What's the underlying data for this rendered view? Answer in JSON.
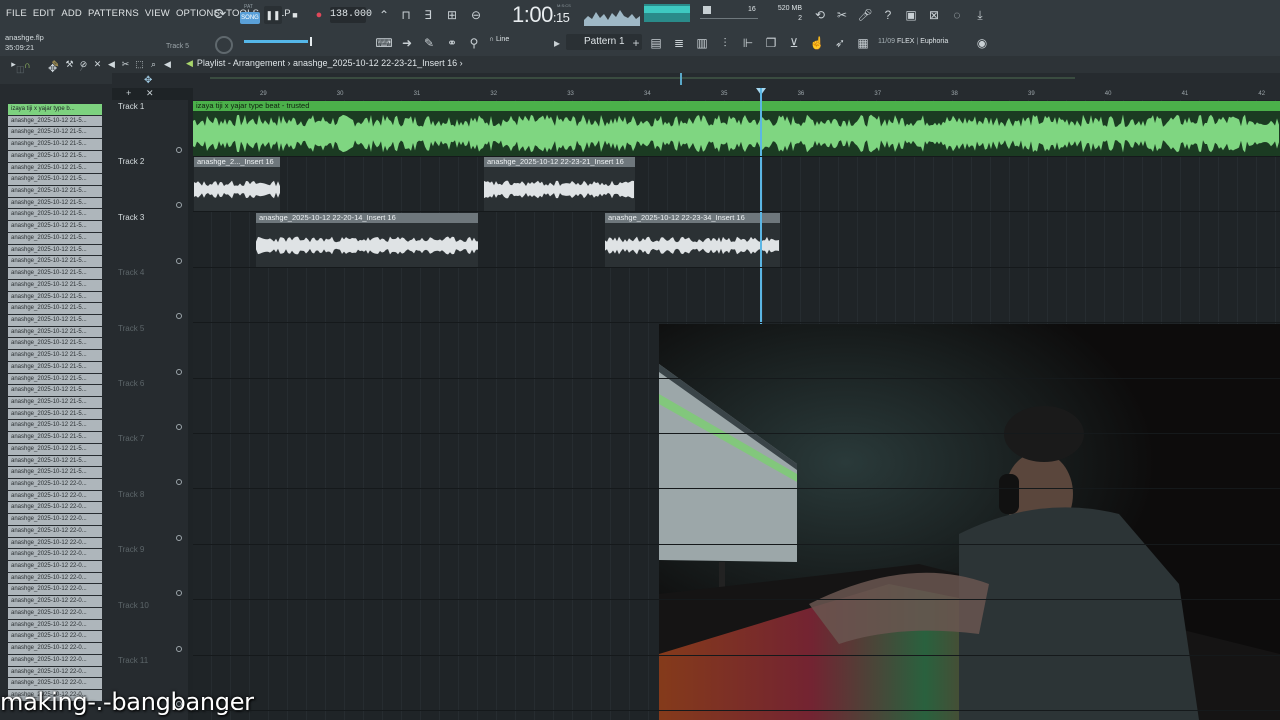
{
  "menu": [
    "FILE",
    "EDIT",
    "ADD",
    "PATTERNS",
    "VIEW",
    "OPTIONS",
    "TOOLS",
    "HELP"
  ],
  "transport": {
    "mode_label": "SONG",
    "pat_label": "PAT",
    "tempo": "138.000",
    "time_main": "1:00",
    "time_sub": "15",
    "time_label": "M:S:CS"
  },
  "memory": {
    "mb": "520 MB",
    "voices": "2",
    "cpu_label": "16"
  },
  "project": {
    "file": "anashge.flp",
    "elapsed": "35:09:21",
    "track_hint": "Track 5"
  },
  "toolbar2": {
    "snap": "Line",
    "pattern": "Pattern 1",
    "preset_num": "11/09",
    "preset_brand": "FLEX",
    "preset_name": "Euphoria"
  },
  "playlist": {
    "title": "Playlist - Arrangement",
    "clip": "anashge_2025-10-12 22-23-21_Insert 16"
  },
  "browser": {
    "items": [
      "izaya tiji x yajar type b...",
      "anashge_2025-10-12 21-5...",
      "anashge_2025-10-12 21-5...",
      "anashge_2025-10-12 21-5...",
      "anashge_2025-10-12 21-5...",
      "anashge_2025-10-12 21-5...",
      "anashge_2025-10-12 21-5...",
      "anashge_2025-10-12 21-5...",
      "anashge_2025-10-12 21-5...",
      "anashge_2025-10-12 21-5...",
      "anashge_2025-10-12 21-5...",
      "anashge_2025-10-12 21-5...",
      "anashge_2025-10-12 21-5...",
      "anashge_2025-10-12 21-5...",
      "anashge_2025-10-12 21-5...",
      "anashge_2025-10-12 21-5...",
      "anashge_2025-10-12 21-5...",
      "anashge_2025-10-12 21-5...",
      "anashge_2025-10-12 21-5...",
      "anashge_2025-10-12 21-5...",
      "anashge_2025-10-12 21-5...",
      "anashge_2025-10-12 21-5...",
      "anashge_2025-10-12 21-5...",
      "anashge_2025-10-12 21-5...",
      "anashge_2025-10-12 21-5...",
      "anashge_2025-10-12 21-5...",
      "anashge_2025-10-12 21-5...",
      "anashge_2025-10-12 21-5...",
      "anashge_2025-10-12 21-5...",
      "anashge_2025-10-12 21-5...",
      "anashge_2025-10-12 21-5...",
      "anashge_2025-10-12 21-5...",
      "anashge_2025-10-12 22-0...",
      "anashge_2025-10-12 22-0...",
      "anashge_2025-10-12 22-0...",
      "anashge_2025-10-12 22-0...",
      "anashge_2025-10-12 22-0...",
      "anashge_2025-10-12 22-0...",
      "anashge_2025-10-12 22-0...",
      "anashge_2025-10-12 22-0...",
      "anashge_2025-10-12 22-0...",
      "anashge_2025-10-12 22-0...",
      "anashge_2025-10-12 22-0...",
      "anashge_2025-10-12 22-0...",
      "anashge_2025-10-12 22-0...",
      "anashge_2025-10-12 22-0...",
      "anashge_2025-10-12 22-0...",
      "anashge_2025-10-12 22-0...",
      "anashge_2025-10-12 22-0...",
      "anashge_2025-10-12 22-0...",
      "anashge_2025-10-12 22-0..."
    ]
  },
  "tracks": [
    "Track 1",
    "Track 2",
    "Track 3",
    "Track 4",
    "Track 5",
    "Track 6",
    "Track 7",
    "Track 8",
    "Track 9",
    "Track 10",
    "Track 11"
  ],
  "ruler": [
    "29",
    "30",
    "31",
    "32",
    "33",
    "34",
    "35",
    "36",
    "37",
    "38",
    "39",
    "40",
    "41",
    "42"
  ],
  "clips": {
    "c1": "izaya tiji x yajar type beat - trusted",
    "c2": "anashge_2..._Insert 16",
    "c3": "anashge_2025-10-12 22-23-21_Insert 16",
    "c4": "anashge_2025-10-12 22-20-14_Insert 16",
    "c5": "anashge_2025-10-12 22-23-34_Insert 16"
  },
  "overlay": {
    "caption": "making-.-bangbanger"
  },
  "colors": {
    "accent": "#4bb04a",
    "playhead": "#5bb6e4",
    "clip_audio": "#6e777c"
  }
}
